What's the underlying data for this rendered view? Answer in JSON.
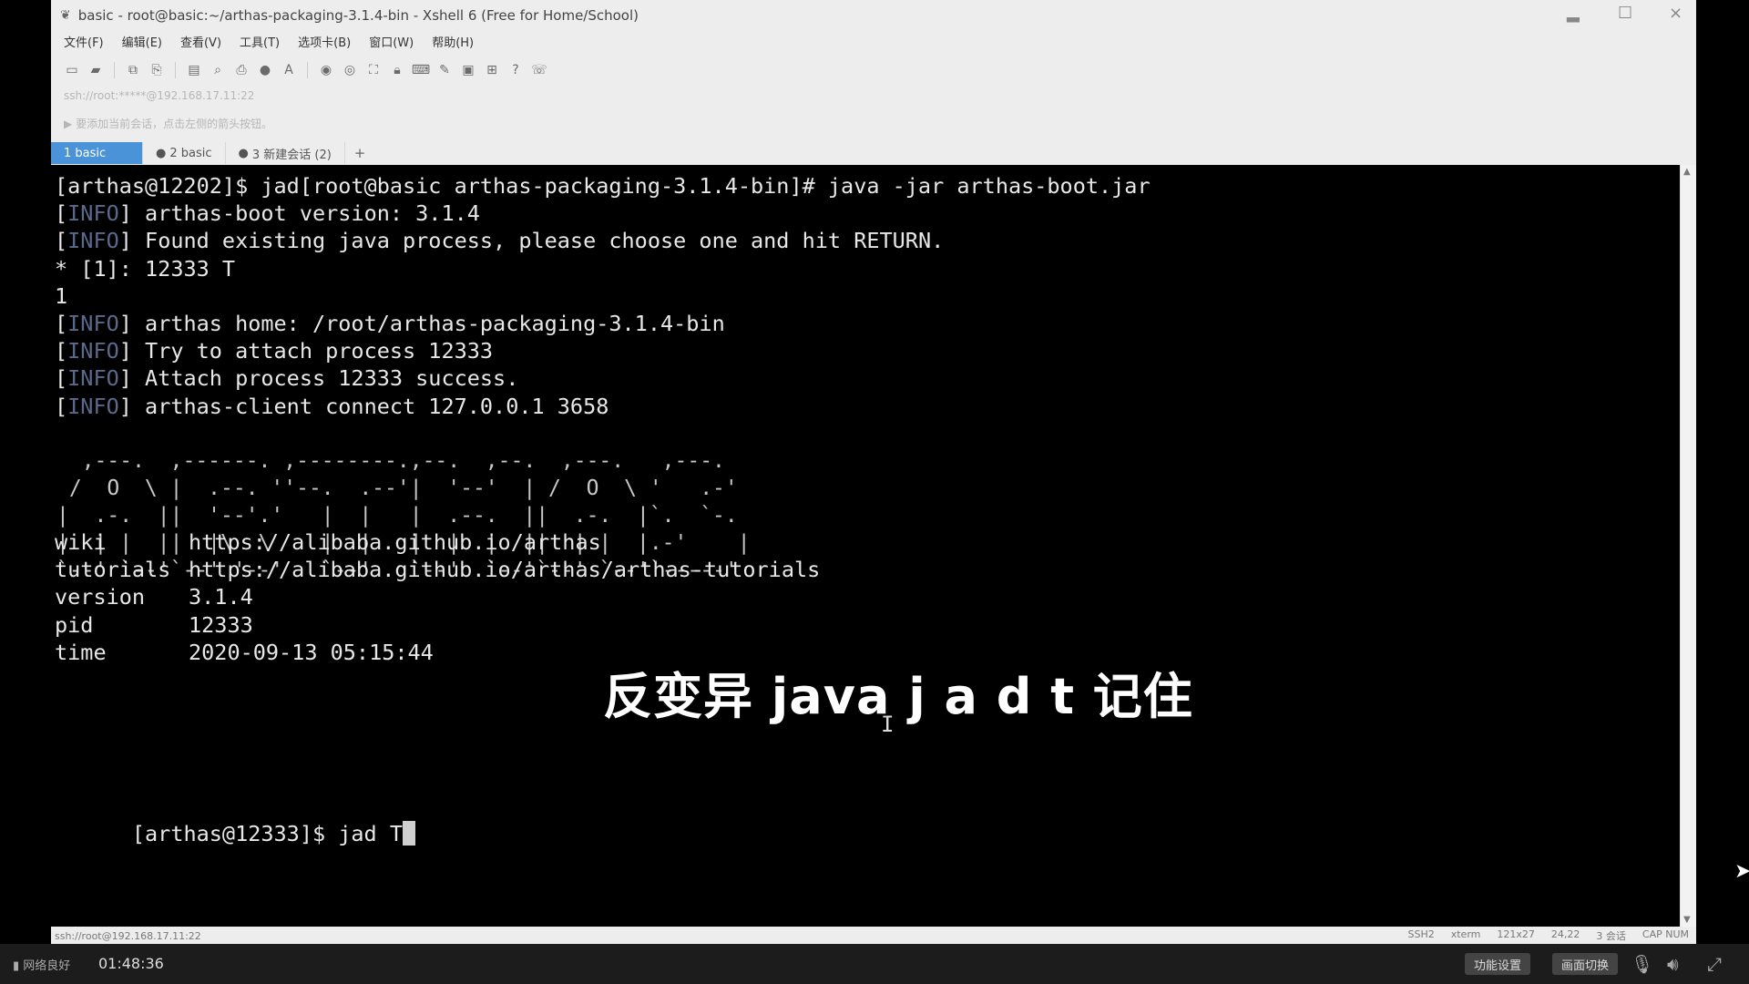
{
  "window": {
    "title": "basic - root@basic:~/arthas-packaging-3.1.4-bin - Xshell 6 (Free for Home/School)",
    "minimize_icon": "minimize-icon",
    "maximize_icon": "maximize-icon",
    "close_label": "×"
  },
  "menu": [
    "文件(F)",
    "编辑(E)",
    "查看(V)",
    "工具(T)",
    "选项卡(B)",
    "窗口(W)",
    "帮助(H)"
  ],
  "address": "ssh://root:*****@192.168.17.11:22",
  "hint": "要添加当前会话，点击左侧的箭头按钮。",
  "tabs": [
    {
      "label": "1 basic",
      "active": true
    },
    {
      "label": "2 basic",
      "active": false
    },
    {
      "label": "3 新建会话 (2)",
      "active": false
    }
  ],
  "tab_add": "+",
  "terminal": {
    "lines": [
      {
        "parts": [
          {
            "t": "[arthas@12202]$ jad[root@basic arthas-packaging-3.1.4-bin]# java -jar arthas-boot.jar"
          }
        ]
      },
      {
        "parts": [
          {
            "t": "["
          },
          {
            "t": "INFO",
            "dim": true
          },
          {
            "t": "] arthas-boot version: 3.1.4"
          }
        ]
      },
      {
        "parts": [
          {
            "t": "["
          },
          {
            "t": "INFO",
            "dim": true
          },
          {
            "t": "] Found existing java process, please choose one and hit RETURN."
          }
        ]
      },
      {
        "parts": [
          {
            "t": "* [1]: 12333 T"
          }
        ]
      },
      {
        "parts": [
          {
            "t": "1"
          }
        ]
      },
      {
        "parts": [
          {
            "t": "["
          },
          {
            "t": "INFO",
            "dim": true
          },
          {
            "t": "] arthas home: /root/arthas-packaging-3.1.4-bin"
          }
        ]
      },
      {
        "parts": [
          {
            "t": "["
          },
          {
            "t": "INFO",
            "dim": true
          },
          {
            "t": "] Try to attach process 12333"
          }
        ]
      },
      {
        "parts": [
          {
            "t": "["
          },
          {
            "t": "INFO",
            "dim": true
          },
          {
            "t": "] Attach process 12333 success."
          }
        ]
      },
      {
        "parts": [
          {
            "t": "["
          },
          {
            "t": "INFO",
            "dim": true
          },
          {
            "t": "] arthas-client connect 127.0.0.1 3658"
          }
        ]
      }
    ],
    "ascii_logo": "  ,---.  ,------. ,--------.,--.  ,--.  ,---.   ,---.\n /  O  \\ |  .--. ''--.  .--'|  '--'  | /  O  \\ '   .-'\n|  .-.  ||  '--'.'   |  |   |  .--.  ||  .-.  |`.  `-.\n|  | |  ||  |\\  \\    |  |   |  |  |  ||  | |  |.-'    |\n`--' `--'`--' '--'   `--'   `--'  `--'`--' `--'`-----'",
    "info": [
      {
        "key": "wiki",
        "value": "https://alibaba.github.io/arthas"
      },
      {
        "key": "tutorials",
        "value": "https://alibaba.github.io/arthas/arthas-tutorials"
      },
      {
        "key": "version",
        "value": "3.1.4"
      },
      {
        "key": "pid",
        "value": "12333"
      },
      {
        "key": "time",
        "value": "2020-09-13 05:15:44"
      }
    ],
    "prompt": "[arthas@12333]$ jad T",
    "cursor_icon": "text-cursor-icon"
  },
  "subtitle": "反变异 java j a d t 记住",
  "statusbar": {
    "left": "ssh://root@192.168.17.11:22",
    "items": [
      "SSH2",
      "xterm",
      "121x27",
      "24,22",
      "3 会话",
      "CAP NUM"
    ]
  },
  "player": {
    "network": "网络良好",
    "time": "01:48:36",
    "buttons": [
      "功能设置",
      "画面切换"
    ],
    "icons": [
      "mic-off-icon",
      "volume-icon",
      "fullscreen-icon"
    ]
  }
}
